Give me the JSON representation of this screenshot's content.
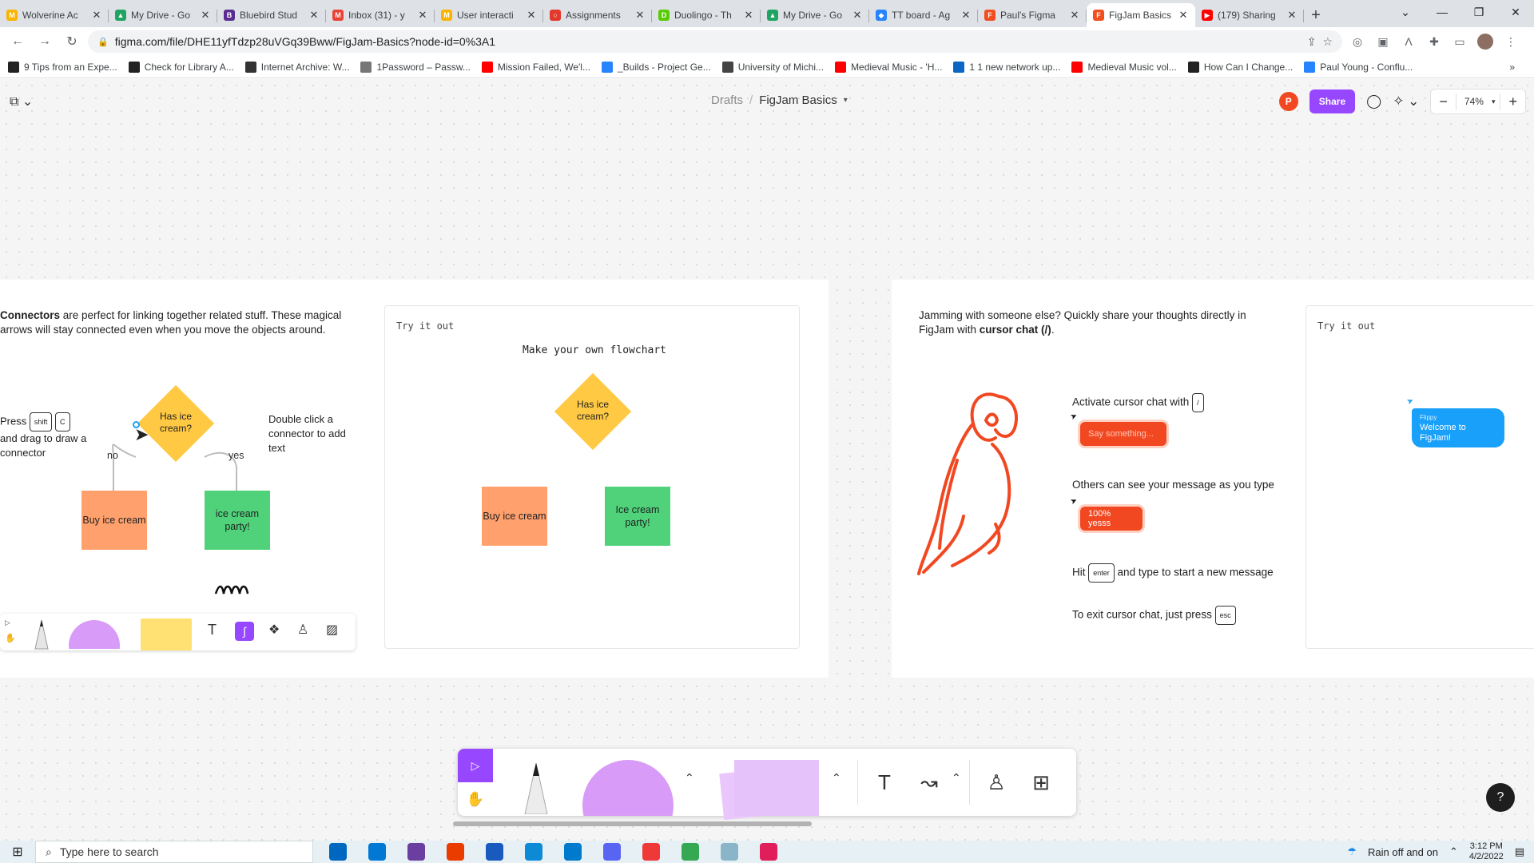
{
  "browser": {
    "tabs": [
      {
        "title": "Wolverine Ac",
        "color": "#f9b400",
        "glyph": "M"
      },
      {
        "title": "My Drive - Go",
        "color": "#1fa463",
        "glyph": "▲"
      },
      {
        "title": "Bluebird Stud",
        "color": "#5c2d91",
        "glyph": "B"
      },
      {
        "title": "Inbox (31) - y",
        "color": "#ea4335",
        "glyph": "M"
      },
      {
        "title": "User interacti",
        "color": "#f9b400",
        "glyph": "M"
      },
      {
        "title": "Assignments",
        "color": "#e2392c",
        "glyph": "○"
      },
      {
        "title": "Duolingo - Th",
        "color": "#58cc02",
        "glyph": "D"
      },
      {
        "title": "My Drive - Go",
        "color": "#1fa463",
        "glyph": "▲"
      },
      {
        "title": "TT board - Ag",
        "color": "#2684ff",
        "glyph": "◆"
      },
      {
        "title": "Paul's Figma",
        "color": "#f24e1e",
        "glyph": "F"
      },
      {
        "title": "FigJam Basics",
        "color": "#f24e1e",
        "glyph": "F",
        "active": true
      },
      {
        "title": "(179) Sharing",
        "color": "#ff0000",
        "glyph": "▶"
      }
    ],
    "url": "figma.com/file/DHE11yfTdzp28uVGq39Bww/FigJam-Basics?node-id=0%3A1",
    "bookmarks": [
      {
        "label": "9 Tips from an Expe...",
        "color": "#222"
      },
      {
        "label": "Check for Library A...",
        "color": "#222"
      },
      {
        "label": "Internet Archive: W...",
        "color": "#333"
      },
      {
        "label": "1Password – Passw...",
        "color": "#777"
      },
      {
        "label": "Mission Failed, We'l...",
        "color": "#ff0000"
      },
      {
        "label": "_Builds - Project Ge...",
        "color": "#2684ff"
      },
      {
        "label": "University of Michi...",
        "color": "#444"
      },
      {
        "label": "Medieval Music - 'H...",
        "color": "#ff0000"
      },
      {
        "label": "1 1 new network up...",
        "color": "#0a66c2"
      },
      {
        "label": "Medieval Music vol...",
        "color": "#ff0000"
      },
      {
        "label": "How Can I Change...",
        "color": "#222"
      },
      {
        "label": "Paul Young - Conflu...",
        "color": "#2684ff"
      }
    ]
  },
  "figjam": {
    "breadcrumb": {
      "parent": "Drafts",
      "separator": "/",
      "file": "FigJam Basics"
    },
    "avatar_initial": "P",
    "share_label": "Share",
    "zoom": "74%",
    "zoom_out": "−",
    "zoom_in": "+",
    "section1": {
      "intro_bold": "Connectors",
      "intro_rest": " are perfect for linking together related stuff. These magical arrows will stay connected even when you move the objects around.",
      "press_label": "Press",
      "key_shift": "shift",
      "key_c": "C",
      "press_rest": "and drag to draw a connector",
      "double_click": "Double click a connector to add text",
      "decision": "Has ice cream?",
      "no": "no",
      "yes": "yes",
      "box_left": "Buy ice cream",
      "box_right": "ice cream party!",
      "try_label": "Try it out",
      "panel_title": "Make your own flowchart",
      "panel_decision": "Has ice cream?",
      "panel_box_left": "Buy ice cream",
      "panel_box_right": "Ice cream party!"
    },
    "section2": {
      "intro_a": "Jamming with someone else? Quickly share your thoughts directly in FigJam with ",
      "intro_bold": "cursor chat (/)",
      "intro_end": ".",
      "activate": "Activate cursor chat with",
      "key_slash": "/",
      "chat_placeholder": "Say something...",
      "others_see": "Others can see your message as you type",
      "chat_typed": "100% yesss",
      "hit": "Hit",
      "key_enter": "enter",
      "hit_rest": "and type to start a new message",
      "exit": "To exit cursor chat, just press",
      "key_esc": "esc",
      "try_label": "Try it out",
      "flippy_name": "Flippy",
      "flippy_msg": "Welcome to FigJam!"
    },
    "help": "?"
  },
  "taskbar": {
    "search_placeholder": "Type here to search",
    "weather": "Rain off and on",
    "time": "3:12 PM",
    "date": "4/2/2022",
    "apps": [
      {
        "name": "store",
        "color": "#0067c0"
      },
      {
        "name": "mail",
        "color": "#0078d4"
      },
      {
        "name": "podcast",
        "color": "#6a3fa0"
      },
      {
        "name": "office",
        "color": "#eb3c00"
      },
      {
        "name": "word",
        "color": "#185abd"
      },
      {
        "name": "edge",
        "color": "#0c8ad6"
      },
      {
        "name": "vscode",
        "color": "#007acc"
      },
      {
        "name": "discord",
        "color": "#5865f2"
      },
      {
        "name": "vivaldi",
        "color": "#ef3939"
      },
      {
        "name": "chrome",
        "color": "#34a853"
      },
      {
        "name": "files",
        "color": "#8ab4c8"
      },
      {
        "name": "slack",
        "color": "#e01e5a"
      }
    ]
  }
}
